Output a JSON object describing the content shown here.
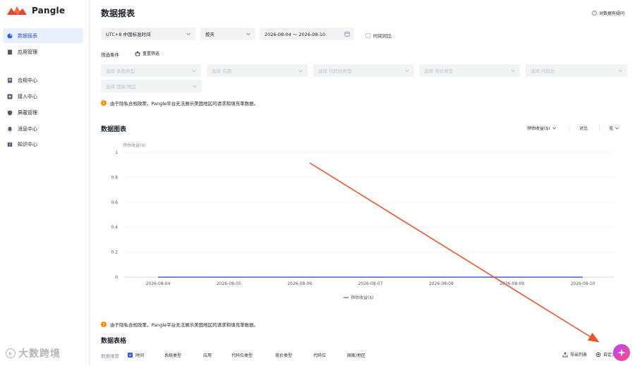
{
  "brand": {
    "name": "Pangle"
  },
  "sidebar": {
    "items": [
      {
        "label": "数据报表",
        "icon": "pie-chart-icon",
        "active": true
      },
      {
        "label": "应用管理",
        "icon": "app-icon"
      },
      {
        "label": "合规中心",
        "icon": "document-icon"
      },
      {
        "label": "接入中心",
        "icon": "plug-icon"
      },
      {
        "label": "屏蔽管理",
        "icon": "shield-icon"
      },
      {
        "label": "消息中心",
        "icon": "bell-icon"
      },
      {
        "label": "知识中心",
        "icon": "book-icon"
      }
    ]
  },
  "header": {
    "title": "数据报表",
    "feedback": "对数据有疑问"
  },
  "filters": {
    "timezone": "UTC+8 中国标准时间",
    "granularity": "按天",
    "date_range": "2026-08-04 ～ 2026-08-10",
    "compare": "时间对比",
    "label": "筛选条件",
    "reset": "重置筛选",
    "placeholders": [
      "选择 系统类型",
      "选择 应用",
      "选择 代码位类型",
      "选择 竞价类型",
      "选择 代码位",
      "选择 国家/地区"
    ]
  },
  "notice": {
    "text": "由于隐私合规政策，Pangle平台无法展示美国地区的请求和填充率数据。"
  },
  "chart_section": {
    "title": "数据图表",
    "metric_select": "预估收益($)",
    "compare_label": "对比",
    "compare_value": "无"
  },
  "chart_data": {
    "type": "line",
    "ylabel": "预估收益($)",
    "categories": [
      "2026-08-04",
      "2026-08-05",
      "2026-08-06",
      "2026-08-07",
      "2026-08-08",
      "2026-08-09",
      "2026-08-10"
    ],
    "y_ticks": [
      "1",
      "0.8",
      "0.6",
      "0.4",
      "0.2",
      "0"
    ],
    "ylim": [
      0,
      1
    ],
    "series": [
      {
        "name": "预估收益($)",
        "values": [
          0,
          0,
          0,
          0,
          0,
          0,
          0
        ],
        "color": "#3357e6"
      }
    ],
    "legend": "bottom-center",
    "grid": true
  },
  "table_section": {
    "title": "数据表格",
    "dimension_label": "数据维度",
    "dimensions": [
      "时间",
      "系统类型",
      "应用",
      "代码位类型",
      "竞价类型",
      "代码位",
      "国家/地区"
    ],
    "export": "导出列表",
    "custom": "自定义"
  },
  "overlay": {
    "watermark": "大数跨境",
    "arrow_color": "#e8562a"
  },
  "colors": {
    "accent": "#3357e6",
    "warning": "#ff8a00"
  }
}
